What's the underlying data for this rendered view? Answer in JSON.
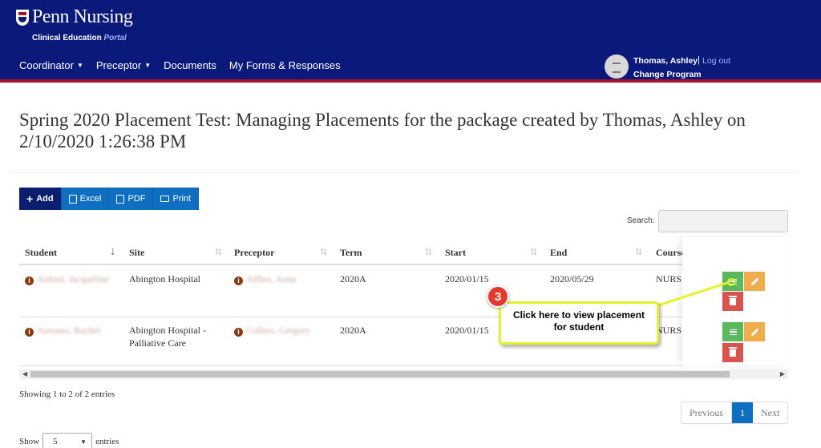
{
  "brand": {
    "name": "Penn Nursing",
    "subtitle_main": "Clinical Education",
    "subtitle_accent": "Portal"
  },
  "nav": {
    "items": [
      {
        "label": "Coordinator",
        "dropdown": true
      },
      {
        "label": "Preceptor",
        "dropdown": true
      },
      {
        "label": "Documents",
        "dropdown": false
      },
      {
        "label": "My Forms & Responses",
        "dropdown": false
      }
    ]
  },
  "user": {
    "name": "Thomas, Ashley",
    "separator": "|",
    "logout": "Log out",
    "change_program": "Change Program"
  },
  "page": {
    "title": "Spring 2020 Placement Test: Managing Placements for the package created by Thomas, Ashley on 2/10/2020 1:26:38 PM"
  },
  "toolbar": {
    "add": "Add",
    "excel": "Excel",
    "pdf": "PDF",
    "print": "Print"
  },
  "search": {
    "label": "Search:",
    "value": ""
  },
  "table": {
    "columns": [
      "Student",
      "Site",
      "Preceptor",
      "Term",
      "Start",
      "End",
      "Course"
    ],
    "rows": [
      {
        "student": "Aldred, Jacqueline",
        "site_line1": "Abington Hospital",
        "site_line2": "",
        "preceptor": "Affleo, Anna",
        "term": "2020A",
        "start": "2020/01/15",
        "end": "2020/05/29",
        "course": "NURS"
      },
      {
        "student": "Amsano, Rachel",
        "site_line1": "Abington Hospital -",
        "site_line2": "Palliative Care",
        "preceptor": "Collins, Gregory",
        "term": "2020A",
        "start": "2020/01/15",
        "end": "",
        "course": "NURS"
      }
    ]
  },
  "info": {
    "showing": "Showing 1 to 2 of 2 entries"
  },
  "pagination": {
    "previous": "Previous",
    "current": "1",
    "next": "Next"
  },
  "length": {
    "show": "Show",
    "value": "5",
    "entries": "entries"
  },
  "callout": {
    "step": "3",
    "line1": "Click here to view placement",
    "line2": "for student"
  },
  "colors": {
    "header_bg": "#0b1a7a",
    "header_stripe": "#a8122b",
    "primary": "#0e6fc0",
    "view_btn": "#5cb85c",
    "edit_btn": "#f0ad4e",
    "delete_btn": "#d9534f",
    "callout_border": "#e6f228",
    "step_badge": "#e5382c"
  }
}
